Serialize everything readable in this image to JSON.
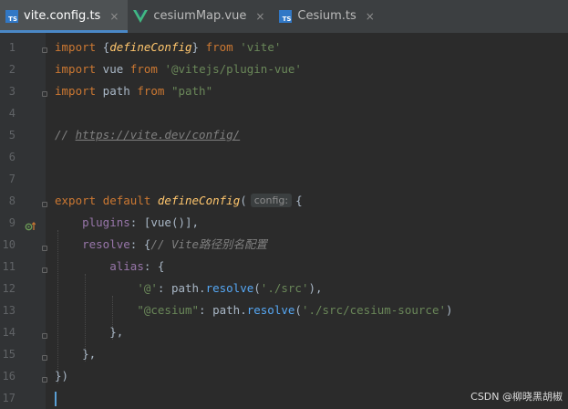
{
  "tabs": [
    {
      "label": "vite.config.ts",
      "type": "ts",
      "active": true
    },
    {
      "label": "cesiumMap.vue",
      "type": "vue",
      "active": false
    },
    {
      "label": "Cesium.ts",
      "type": "ts",
      "active": false
    }
  ],
  "icons": {
    "ts_badge": "TS",
    "close": "×"
  },
  "line_numbers": [
    "1",
    "2",
    "3",
    "4",
    "5",
    "6",
    "7",
    "8",
    "9",
    "10",
    "11",
    "12",
    "13",
    "14",
    "15",
    "16",
    "17"
  ],
  "code": {
    "l1": {
      "kw": "import",
      "p1": " {",
      "fn": "defineConfig",
      "p2": "} ",
      "kw2": "from",
      "sp": " ",
      "str": "'vite'"
    },
    "l2": {
      "kw": "import",
      "p1": " vue ",
      "kw2": "from",
      "sp": " ",
      "str": "'@vitejs/plugin-vue'"
    },
    "l3": {
      "kw": "import",
      "p1": " path ",
      "kw2": "from",
      "sp": " ",
      "str": "\"path\""
    },
    "l5": {
      "prefix": "// ",
      "link": "https://vite.dev/config/"
    },
    "l8": {
      "kw": "export",
      "sp1": " ",
      "kw2": "default",
      "sp2": " ",
      "fn": "defineConfig",
      "p1": "(",
      "hint": "config:",
      "p2": "{"
    },
    "l9": {
      "indent": "    ",
      "prop": "plugins",
      "rest": ": [vue()],"
    },
    "l10": {
      "indent": "    ",
      "prop": "resolve",
      "rest": ": {",
      "cm": "// Vite路径别名配置"
    },
    "l11": {
      "indent": "        ",
      "prop": "alias",
      "rest": ": {"
    },
    "l12": {
      "indent": "            ",
      "str": "'@'",
      "p1": ": path.",
      "method": "resolve",
      "p2": "(",
      "str2": "'./src'",
      "p3": "),"
    },
    "l13": {
      "indent": "            ",
      "str": "\"@cesium\"",
      "p1": ": path.",
      "method": "resolve",
      "p2": "(",
      "str2": "'./src/cesium-source'",
      "p3": ")"
    },
    "l14": {
      "text": "        },"
    },
    "l15": {
      "text": "    },"
    },
    "l16": {
      "text": "})"
    }
  },
  "watermark": "CSDN @柳晓黑胡椒",
  "colors": {
    "keyword": "#cc7832",
    "string": "#6a8759",
    "function": "#ffc66d",
    "property": "#9876aa",
    "comment": "#808080",
    "method": "#56a8f5",
    "ts_icon": "#3178c6",
    "vue_icon": "#41b883"
  }
}
